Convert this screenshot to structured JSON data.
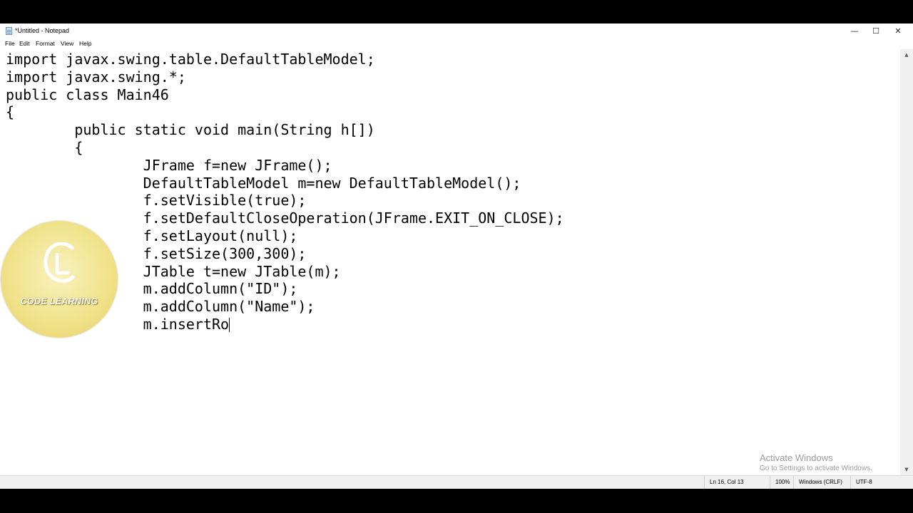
{
  "window": {
    "title": "*Untitled - Notepad",
    "minimize_glyph": "—",
    "maximize_glyph": "☐",
    "close_glyph": "✕"
  },
  "menu": {
    "items": [
      "File",
      "Edit",
      "Format",
      "View",
      "Help"
    ]
  },
  "editor": {
    "code": "import javax.swing.table.DefaultTableModel;\nimport javax.swing.*;\npublic class Main46\n{\n\tpublic static void main(String h[])\n\t{\n\t\tJFrame f=new JFrame();\n\t\tDefaultTableModel m=new DefaultTableModel();\n\t\tf.setVisible(true);\n\t\tf.setDefaultCloseOperation(JFrame.EXIT_ON_CLOSE);\n\t\tf.setLayout(null);\n\t\tf.setSize(300,300);\n\t\tJTable t=new JTable(m);\n\t\tm.addColumn(\"ID\");\n\t\tm.addColumn(\"Name\");\n\t\tm.insertRo"
  },
  "status": {
    "position": "Ln 16, Col 13",
    "zoom": "100%",
    "line_ending": "Windows (CRLF)",
    "encoding": "UTF-8"
  },
  "watermark": {
    "activate_title": "Activate Windows",
    "activate_sub": "Go to Settings to activate Windows."
  },
  "logo": {
    "text": "CODE LEARNING",
    "colors": {
      "disc": "#f1e38c",
      "mark": "#ffffff"
    }
  },
  "icons": {
    "app": "notepad-icon",
    "minimize": "minimize-icon",
    "maximize": "maximize-icon",
    "close": "close-icon",
    "scroll_up": "chevron-up-icon",
    "scroll_down": "chevron-down-icon"
  }
}
